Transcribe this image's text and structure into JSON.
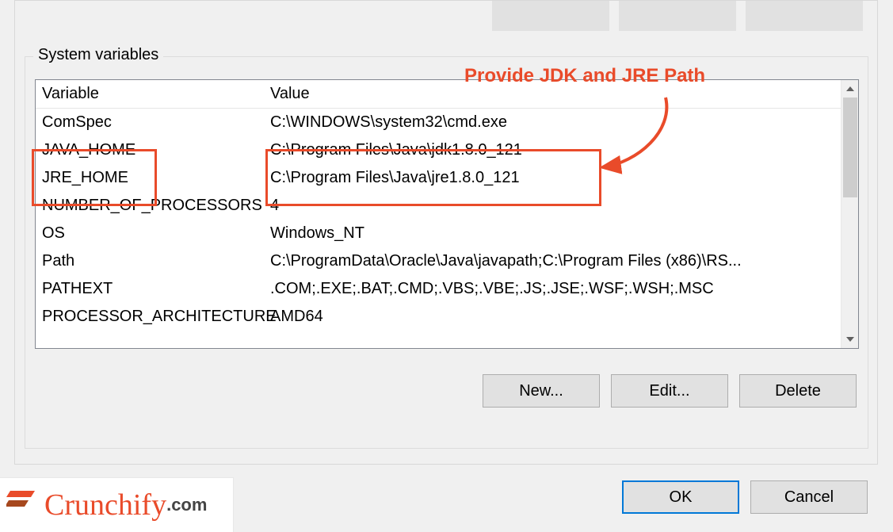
{
  "fieldset_label": "System variables",
  "annotation_text": "Provide JDK and JRE Path",
  "columns": {
    "variable": "Variable",
    "value": "Value"
  },
  "rows": [
    {
      "variable": "ComSpec",
      "value": "C:\\WINDOWS\\system32\\cmd.exe"
    },
    {
      "variable": "JAVA_HOME",
      "value": "C:\\Program Files\\Java\\jdk1.8.0_121"
    },
    {
      "variable": "JRE_HOME",
      "value": "C:\\Program Files\\Java\\jre1.8.0_121"
    },
    {
      "variable": "NUMBER_OF_PROCESSORS",
      "value": "4"
    },
    {
      "variable": "OS",
      "value": "Windows_NT"
    },
    {
      "variable": "Path",
      "value": "C:\\ProgramData\\Oracle\\Java\\javapath;C:\\Program Files (x86)\\RS..."
    },
    {
      "variable": "PATHEXT",
      "value": ".COM;.EXE;.BAT;.CMD;.VBS;.VBE;.JS;.JSE;.WSF;.WSH;.MSC"
    },
    {
      "variable": "PROCESSOR_ARCHITECTURE",
      "value": "AMD64"
    }
  ],
  "buttons": {
    "new": "New...",
    "edit": "Edit...",
    "delete": "Delete",
    "ok": "OK",
    "cancel": "Cancel"
  },
  "logo": {
    "brand": "Crunchify",
    "tld": ".com"
  }
}
